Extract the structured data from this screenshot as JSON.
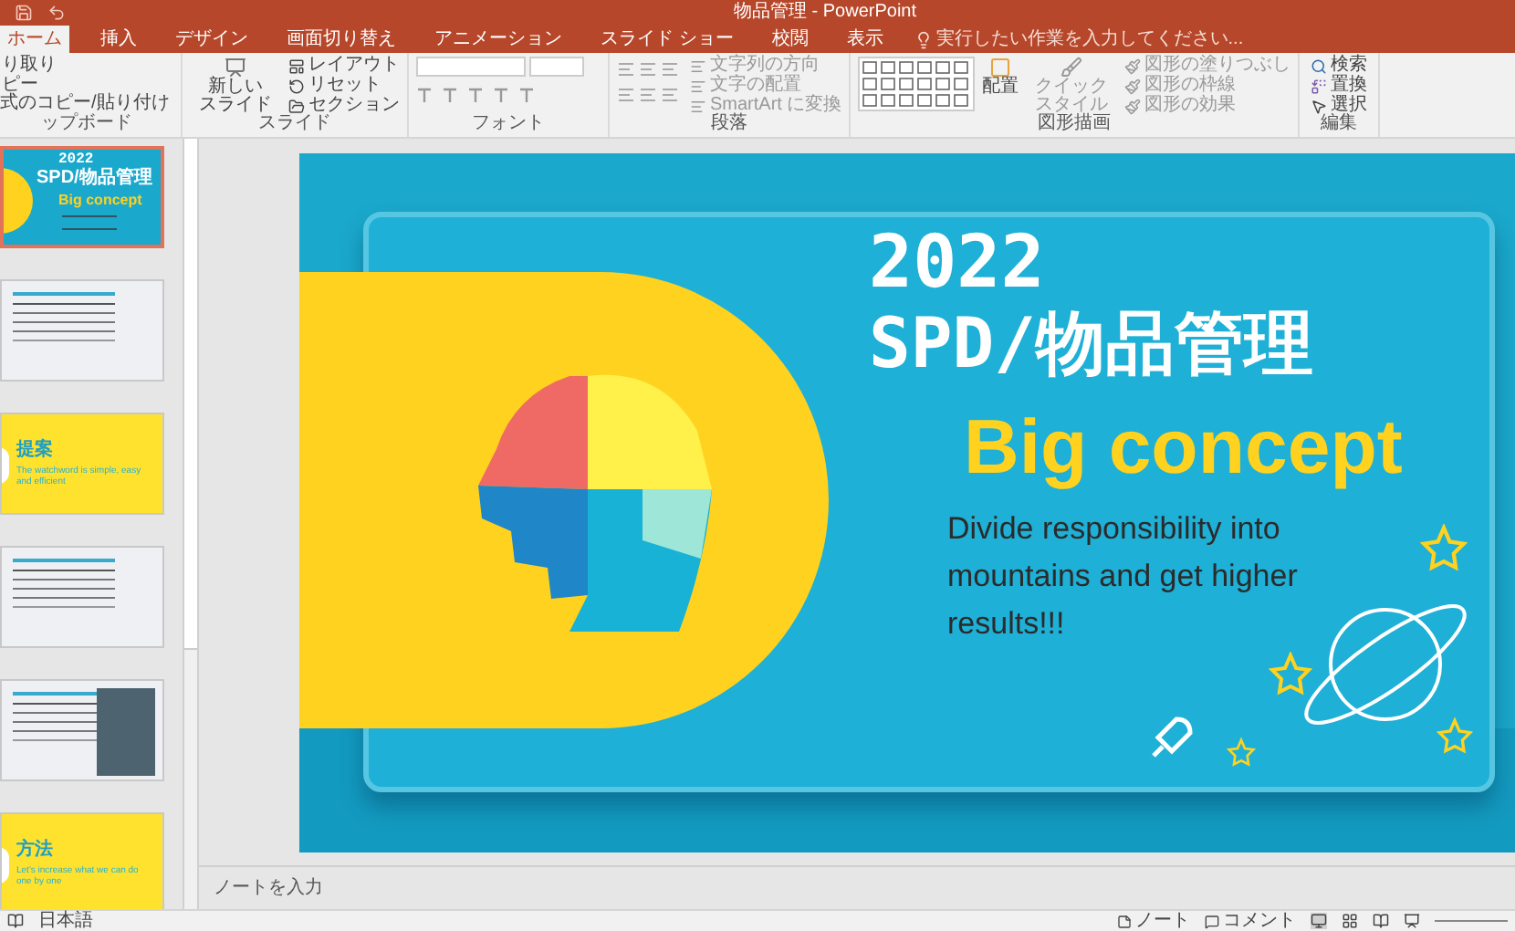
{
  "window": {
    "title": "物品管理 - PowerPoint"
  },
  "tabs": [
    {
      "label": "ホーム",
      "selected": true
    },
    {
      "label": "挿入",
      "selected": false
    },
    {
      "label": "デザイン",
      "selected": false
    },
    {
      "label": "画面切り替え",
      "selected": false
    },
    {
      "label": "アニメーション",
      "selected": false
    },
    {
      "label": "スライド ショー",
      "selected": false
    },
    {
      "label": "校閲",
      "selected": false
    },
    {
      "label": "表示",
      "selected": false
    }
  ],
  "tell_me": {
    "placeholder": "実行したい作業を入力してください..."
  },
  "ribbon": {
    "clipboard": {
      "items": [
        "り取り",
        "ピー",
        "式のコピー/貼り付け"
      ],
      "label": "ップボード"
    },
    "slides": {
      "new_slide": [
        "新しい",
        "スライド"
      ],
      "items": [
        "レイアウト",
        "リセット",
        "セクション"
      ],
      "label": "スライド"
    },
    "font": {
      "label": "フォント"
    },
    "paragraph": {
      "items": [
        "文字列の方向",
        "文字の配置",
        "SmartArt に変換"
      ],
      "label": "段落"
    },
    "drawing": {
      "arrange": "配置",
      "quick_styles": [
        "クイック",
        "スタイル"
      ],
      "items": [
        "図形の塗りつぶし",
        "図形の枠線",
        "図形の効果"
      ],
      "label": "図形描画"
    },
    "editing": {
      "items": [
        "検索",
        "置換",
        "選択"
      ],
      "label": "編集"
    }
  },
  "thumbnails": [
    {
      "kind": "cover",
      "selected": true,
      "year": "2022",
      "title": "SPD/物品管理",
      "subtitle": "Big concept"
    },
    {
      "kind": "text",
      "selected": false
    },
    {
      "kind": "section",
      "selected": false,
      "heading": "提案",
      "tagline": "The watchword is simple, easy and efficient"
    },
    {
      "kind": "text",
      "selected": false
    },
    {
      "kind": "photo",
      "selected": false
    },
    {
      "kind": "section",
      "selected": false,
      "heading": "方法",
      "tagline": "Let's increase what we can do one by one"
    }
  ],
  "slide": {
    "year": "2022",
    "title": "SPD/物品管理",
    "subtitle": "Big concept",
    "body": "Divide responsibility into mountains and get higher results!!!"
  },
  "notes": {
    "placeholder": "ノートを入力"
  },
  "status_bar": {
    "language": "日本語",
    "notes": "ノート",
    "comments": "コメント"
  }
}
